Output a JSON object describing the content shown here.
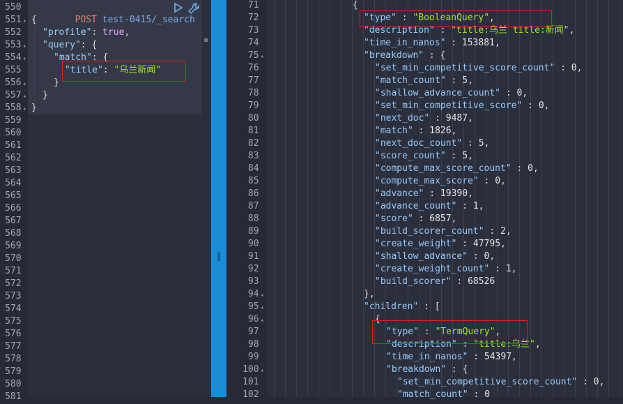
{
  "request": {
    "method": "POST",
    "path": "test-0415/_search",
    "run_icon": "play-icon",
    "settings_icon": "wrench-icon"
  },
  "left_lines": [
    {
      "num": "550",
      "fold": false
    },
    {
      "num": "551",
      "fold": true
    },
    {
      "num": "552",
      "fold": false
    },
    {
      "num": "553",
      "fold": true
    },
    {
      "num": "554",
      "fold": true
    },
    {
      "num": "555",
      "fold": false
    },
    {
      "num": "556",
      "fold": true
    },
    {
      "num": "557",
      "fold": true
    },
    {
      "num": "558",
      "fold": true
    },
    {
      "num": "559",
      "fold": false
    },
    {
      "num": "560",
      "fold": false
    },
    {
      "num": "561",
      "fold": false
    },
    {
      "num": "562",
      "fold": false
    },
    {
      "num": "563",
      "fold": false
    },
    {
      "num": "564",
      "fold": false
    },
    {
      "num": "565",
      "fold": false
    },
    {
      "num": "566",
      "fold": false
    },
    {
      "num": "567",
      "fold": false
    },
    {
      "num": "568",
      "fold": false
    },
    {
      "num": "569",
      "fold": false
    },
    {
      "num": "570",
      "fold": false
    },
    {
      "num": "571",
      "fold": false
    },
    {
      "num": "572",
      "fold": false
    },
    {
      "num": "573",
      "fold": false
    },
    {
      "num": "574",
      "fold": false
    },
    {
      "num": "575",
      "fold": false
    },
    {
      "num": "576",
      "fold": false
    },
    {
      "num": "577",
      "fold": false
    },
    {
      "num": "578",
      "fold": false
    },
    {
      "num": "579",
      "fold": false
    },
    {
      "num": "580",
      "fold": false
    },
    {
      "num": "581",
      "fold": false
    }
  ],
  "query": {
    "open": "{",
    "profile_key": "\"profile\"",
    "profile_val": "true",
    "query_key": "\"query\"",
    "match_key": "\"match\"",
    "title_key": "\"title\"",
    "title_val": "\"乌兰新闻\"",
    "close_inner": "}",
    "close_mid": "}",
    "close_outer": "}"
  },
  "right_lines": [
    {
      "num": "71",
      "fold": false
    },
    {
      "num": "72",
      "fold": false
    },
    {
      "num": "73",
      "fold": false
    },
    {
      "num": "74",
      "fold": false
    },
    {
      "num": "75",
      "fold": true
    },
    {
      "num": "76",
      "fold": false
    },
    {
      "num": "77",
      "fold": false
    },
    {
      "num": "78",
      "fold": false
    },
    {
      "num": "79",
      "fold": false
    },
    {
      "num": "80",
      "fold": false
    },
    {
      "num": "81",
      "fold": false
    },
    {
      "num": "82",
      "fold": false
    },
    {
      "num": "83",
      "fold": false
    },
    {
      "num": "84",
      "fold": false
    },
    {
      "num": "85",
      "fold": false
    },
    {
      "num": "86",
      "fold": false
    },
    {
      "num": "87",
      "fold": false
    },
    {
      "num": "88",
      "fold": false
    },
    {
      "num": "89",
      "fold": false
    },
    {
      "num": "90",
      "fold": false
    },
    {
      "num": "91",
      "fold": false
    },
    {
      "num": "92",
      "fold": false
    },
    {
      "num": "93",
      "fold": false
    },
    {
      "num": "94",
      "fold": true
    },
    {
      "num": "95",
      "fold": true
    },
    {
      "num": "96",
      "fold": true
    },
    {
      "num": "97",
      "fold": false
    },
    {
      "num": "98",
      "fold": false
    },
    {
      "num": "99",
      "fold": false
    },
    {
      "num": "100",
      "fold": true
    },
    {
      "num": "101",
      "fold": false
    },
    {
      "num": "102",
      "fold": false
    }
  ],
  "response": {
    "open": "{",
    "type_key": "\"type\"",
    "type_val": "\"BooleanQuery\"",
    "description_key": "\"description\"",
    "description_val": "\"title:乌兰 title:新闻\"",
    "time_key": "\"time_in_nanos\"",
    "time_val": "153881",
    "breakdown_key": "\"breakdown\"",
    "breakdown": [
      {
        "k": "\"set_min_competitive_score_count\"",
        "v": "0"
      },
      {
        "k": "\"match_count\"",
        "v": "5"
      },
      {
        "k": "\"shallow_advance_count\"",
        "v": "0"
      },
      {
        "k": "\"set_min_competitive_score\"",
        "v": "0"
      },
      {
        "k": "\"next_doc\"",
        "v": "9487"
      },
      {
        "k": "\"match\"",
        "v": "1826"
      },
      {
        "k": "\"next_doc_count\"",
        "v": "5"
      },
      {
        "k": "\"score_count\"",
        "v": "5"
      },
      {
        "k": "\"compute_max_score_count\"",
        "v": "0"
      },
      {
        "k": "\"compute_max_score\"",
        "v": "0"
      },
      {
        "k": "\"advance\"",
        "v": "19390"
      },
      {
        "k": "\"advance_count\"",
        "v": "1"
      },
      {
        "k": "\"score\"",
        "v": "6857"
      },
      {
        "k": "\"build_scorer_count\"",
        "v": "2"
      },
      {
        "k": "\"create_weight\"",
        "v": "47795"
      },
      {
        "k": "\"shallow_advance\"",
        "v": "0"
      },
      {
        "k": "\"create_weight_count\"",
        "v": "1"
      },
      {
        "k": "\"build_scorer\"",
        "v": "68526"
      }
    ],
    "breakdown_close": "},",
    "children_key": "\"children\"",
    "child_open": "{",
    "child_type_key": "\"type\"",
    "child_type_val": "\"TermQuery\"",
    "child_desc_key": "\"description\"",
    "child_desc_val": "\"title:乌兰\"",
    "child_time_key": "\"time_in_nanos\"",
    "child_time_val": "54397",
    "child_breakdown_key": "\"breakdown\"",
    "child_b1_key": "\"set_min_competitive_score_count\"",
    "child_b1_val": "0",
    "child_b2_key": "\"match_count\"",
    "child_b2_val": "0"
  },
  "colors": {
    "highlight_box": "#e01f1f",
    "divider": "#1a8cd8"
  }
}
